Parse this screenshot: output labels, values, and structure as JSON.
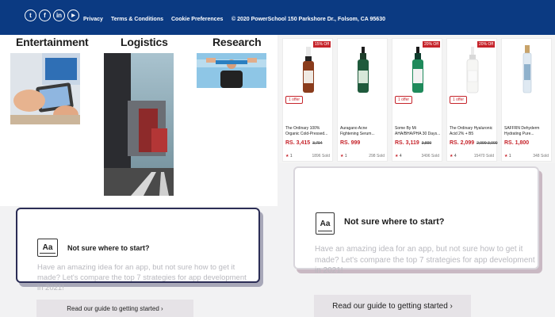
{
  "header": {
    "social": [
      {
        "icon": "twitter-icon",
        "glyph": "t"
      },
      {
        "icon": "facebook-icon",
        "glyph": "f"
      },
      {
        "icon": "linkedin-icon",
        "glyph": "in"
      },
      {
        "icon": "youtube-icon",
        "glyph": "▶"
      }
    ],
    "links": {
      "privacy": "Privacy",
      "terms": "Terms & Conditions",
      "cookies": "Cookie Preferences"
    },
    "copyright": "© 2020 PowerSchool 150 Parkshore Dr., Folsom, CA 95630",
    "bg_color": "#0b3a82"
  },
  "categories": [
    "Entertainment",
    "Logistics",
    "Research"
  ],
  "products": [
    {
      "badge": "15% Off",
      "offer": "1 offer",
      "name": "The Ordinary 100% Organic Cold-Pressed...",
      "price": "RS. 3,415",
      "old_price": "3,794",
      "rating": "1",
      "sold": "1896 Sold"
    },
    {
      "badge": "",
      "offer": "",
      "name": "Auragano Acne Fightening Serum...",
      "price": "RS. 999",
      "old_price": "",
      "rating": "1",
      "sold": "298 Sold"
    },
    {
      "badge": "20% Off",
      "offer": "1 offer",
      "name": "Some By Mi AHA/BHA/PHA 30 Days...",
      "price": "RS. 3,119",
      "old_price": "3,899",
      "rating": "4",
      "sold": "3496 Sold"
    },
    {
      "badge": "20% Off",
      "offer": "1 offer",
      "name": "The Ordinary Hyaluronic Acid 2% + B5",
      "price": "RS. 2,099",
      "old_price": "2,999 3,000",
      "rating": "4",
      "sold": "15470 Sold"
    },
    {
      "badge": "",
      "offer": "",
      "name": "SAFFRN Dehyderm Hydrating Pure...",
      "price": "RS. 1,800",
      "old_price": "",
      "rating": "1",
      "sold": "348 Sold"
    }
  ],
  "start_card": {
    "title": "Not sure where to start?",
    "body": "Have an amazing idea for an app, but not sure how to get it made? Let's compare the top 7 strategies for app development in 2021!",
    "button": "Read our guide to getting started ›",
    "icon_text": "Aa"
  },
  "colors": {
    "accent_red": "#c6242b",
    "card_border": "#2b2d55"
  }
}
